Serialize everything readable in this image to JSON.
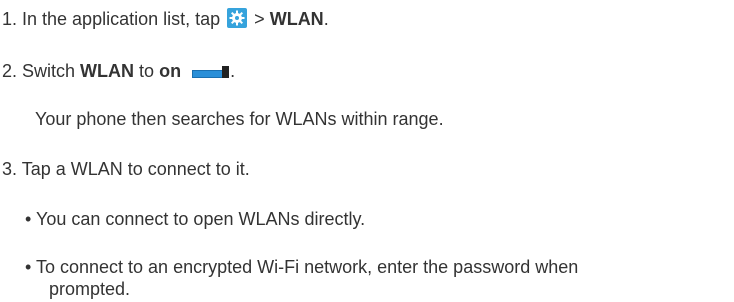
{
  "steps": {
    "s1": {
      "prefix": "1. In the application list, tap",
      "sep": ">",
      "target": "WLAN",
      "end": ".",
      "icon": "settings-gear-icon",
      "icon_color": "#36a3dc"
    },
    "s2": {
      "prefix": "2. Switch",
      "bold1": "WLAN",
      "mid": "to",
      "bold2": "on",
      "end": ".",
      "icon": "toggle-on-icon",
      "toggle_color": "#2a8fd8"
    },
    "s2_note": "Your phone then searches for WLANs within range.",
    "s3": "3. Tap a WLAN to connect to it.",
    "bullets": [
      "• You can connect to open WLANs directly.",
      "• To connect to an encrypted Wi-Fi network, enter the password when",
      "prompted."
    ]
  }
}
